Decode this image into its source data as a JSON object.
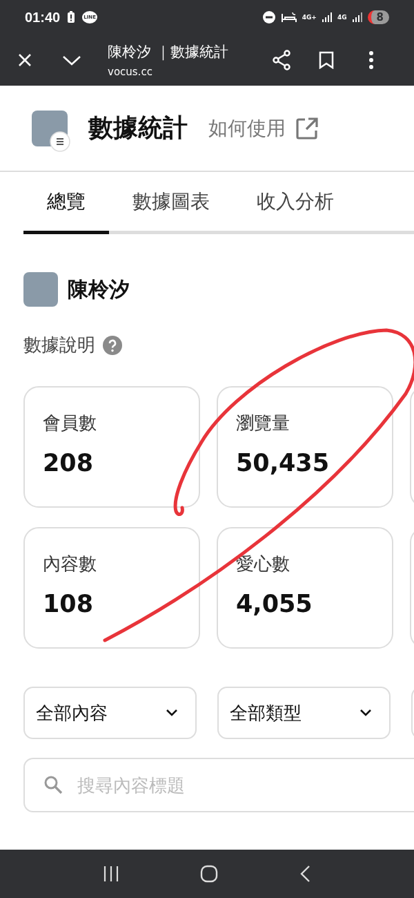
{
  "status_bar": {
    "time": "01:40",
    "line_badge": "LINE",
    "network_1": "4G+",
    "network_2": "4G",
    "battery": "8"
  },
  "browser_bar": {
    "page_title": "陳柃汐 ｜數據統計",
    "url": "vocus.cc"
  },
  "header": {
    "title": "數據統計",
    "help_link": "如何使用"
  },
  "tabs": [
    {
      "label": "總覽",
      "selected": true
    },
    {
      "label": "數據圖表",
      "selected": false
    },
    {
      "label": "收入分析",
      "selected": false
    }
  ],
  "creator": {
    "name": "陳柃汐"
  },
  "info": {
    "label": "數據說明"
  },
  "stats": [
    {
      "label": "會員數",
      "value": "208"
    },
    {
      "label": "瀏覽量",
      "value": "50,435"
    },
    {
      "label": "內容數",
      "value": "108"
    },
    {
      "label": "愛心數",
      "value": "4,055"
    }
  ],
  "filters": [
    {
      "value": "全部內容"
    },
    {
      "value": "全部類型"
    }
  ],
  "search": {
    "placeholder": "搜尋內容標題"
  }
}
